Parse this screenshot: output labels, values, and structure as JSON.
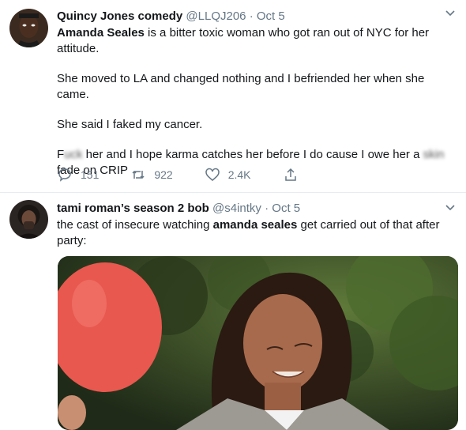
{
  "tweets": [
    {
      "name": "Quincy Jones comedy",
      "handle": "@LLQJ206",
      "separator": "·",
      "date": "Oct 5",
      "text": {
        "line1_name": "Amanda Seales",
        "line1_rest": " is a bitter toxic woman who got ran out of NYC for her",
        "line2": "attitude.",
        "line3": "She moved to LA and changed nothing and I befriended her when she came.",
        "line4": "She said I faked my cancer.",
        "line5_start": "F",
        "line5_blur1": "uck",
        "line5_mid": " her and I hope karma catches her before I do cause I owe her a ",
        "line5_blur2": "skin",
        "line6": "fade on CRIP"
      },
      "actions": {
        "replies": "151",
        "retweets": "922",
        "likes": "2.4K"
      }
    },
    {
      "name": "tami roman’s season 2 bob",
      "handle": "@s4intky",
      "separator": "·",
      "date": "Oct 5",
      "text": {
        "part1": "the cast of insecure watching ",
        "bold": "amanda seales",
        "part2": " get carried out of that after",
        "line2": "party:"
      }
    }
  ],
  "icons": [
    "chevron-down-icon",
    "reply-icon",
    "retweet-icon",
    "like-icon",
    "share-icon"
  ],
  "colors": {
    "muted": "#657786",
    "text": "#14171a",
    "border": "#e6ecf0"
  }
}
